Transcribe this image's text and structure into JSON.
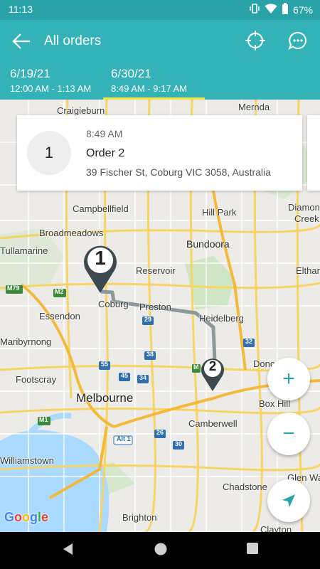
{
  "status_bar": {
    "time": "11:13",
    "battery_text": "67%",
    "icons": [
      "vibrate-icon",
      "wifi-icon",
      "battery-icon"
    ]
  },
  "app_bar": {
    "title": "All orders",
    "back_icon": "arrow-back-icon",
    "actions": [
      "crosshair-target-icon",
      "chat-bubble-icon"
    ]
  },
  "tabs": [
    {
      "date": "6/19/21",
      "range": "12:00 AM - 1:13 AM",
      "selected": false
    },
    {
      "date": "6/30/21",
      "range": "8:49 AM - 9:17 AM",
      "selected": true
    }
  ],
  "order_card": {
    "number": "1",
    "time": "8:49 AM",
    "name": "Order 2",
    "address": "39 Fischer St, Coburg VIC 3058, Australia"
  },
  "markers": [
    "1",
    "2"
  ],
  "map_labels": {
    "craigieburn": "Craigieburn",
    "mernda": "Mernda",
    "campbellfield": "Campbellfield",
    "hill_park": "Hill Park",
    "diamond": "Diamon",
    "creek": "Creek",
    "broadmeadows": "Broadmeadows",
    "bundoora": "Bundoora",
    "tullamarine": "Tullamarine",
    "reservoir": "Reservoir",
    "eltham": "Eltham",
    "coburg": "Coburg",
    "preston": "Preston",
    "essendon": "Essendon",
    "heidelberg": "Heidelberg",
    "maribyrnong": "Maribyrnong",
    "footscray": "Footscray",
    "doncaster": "Donc",
    "melbourne": "Melbourne",
    "box_hill": "Box Hill",
    "camberwell": "Camberwell",
    "williamstown": "Williamstown",
    "glen_waverley": "Glen Wa",
    "chadstone": "Chadstone",
    "brighton": "Brighton",
    "clayton": "Clayton"
  },
  "road_shields": {
    "m79": "M79",
    "m2": "M2",
    "r29": "29",
    "r38": "38",
    "r55": "55",
    "r45": "45",
    "r34": "34",
    "m1": "M1",
    "alt1": "Alt 1",
    "r26": "26",
    "r30": "30",
    "r32": "32",
    "m3": "M"
  },
  "map_controls": {
    "zoom_in": "+",
    "zoom_out": "−",
    "nav_icon": "navigation-arrow-icon"
  },
  "attribution": {
    "letters": [
      "G",
      "o",
      "o",
      "g",
      "l",
      "e"
    ]
  },
  "colors": {
    "accent": "#33b3b8",
    "status_bar": "#2aa3a8",
    "tab_indicator": "#f2e23a",
    "marker": "#3c4a4f",
    "route": "#8a9a9a",
    "water": "#aadaff"
  }
}
